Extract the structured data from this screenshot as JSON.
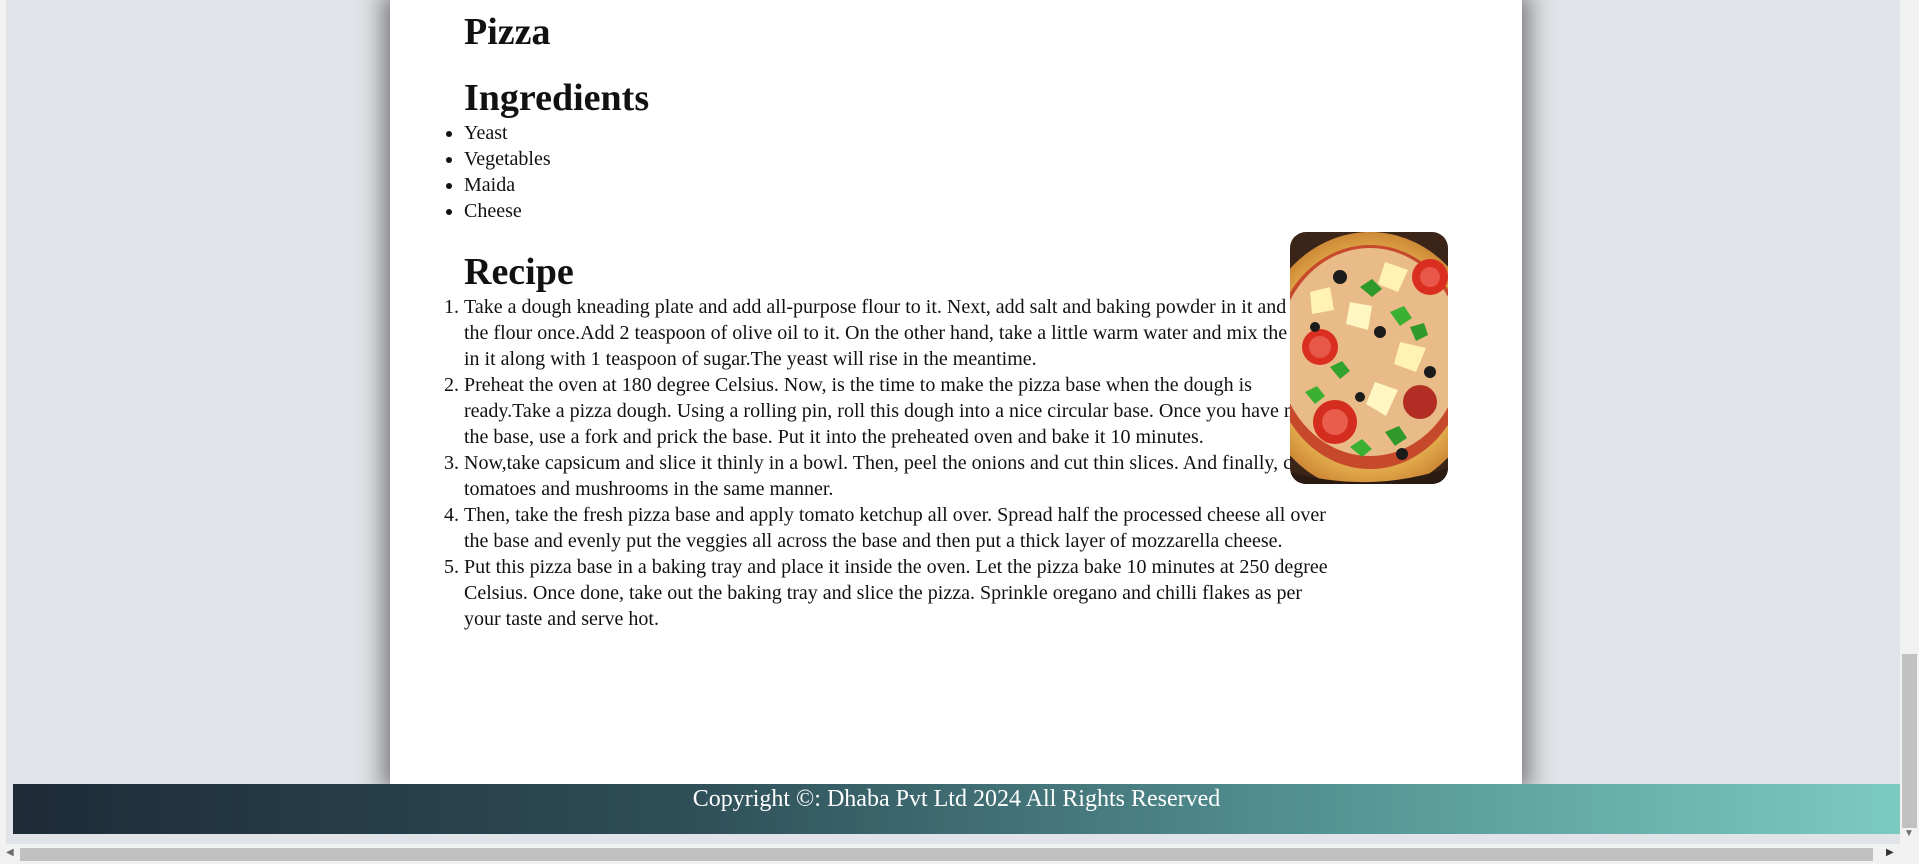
{
  "page": {
    "dish_title": "Pizza",
    "ingredients_title": "Ingredients",
    "ingredients": [
      "Yeast",
      "Vegetables",
      "Maida",
      "Cheese"
    ],
    "recipe_title": "Recipe",
    "steps": [
      "Take a dough kneading plate and add all-purpose flour to it. Next, add salt and baking powder in it and sieve the flour once.Add 2 teaspoon of olive oil to it. On the other hand, take a little warm water and mix the yeast in it along with 1 teaspoon of sugar.The yeast will rise in the meantime.",
      "Preheat the oven at 180 degree Celsius. Now, is the time to make the pizza base when the dough is ready.Take a pizza dough. Using a rolling pin, roll this dough into a nice circular base. Once you have made the base, use a fork and prick the base. Put it into the preheated oven and bake it 10 minutes.",
      "Now,take capsicum and slice it thinly in a bowl. Then, peel the onions and cut thin slices. And finally, cut tomatoes and mushrooms in the same manner.",
      "Then, take the fresh pizza base and apply tomato ketchup all over. Spread half the processed cheese all over the base and evenly put the veggies all across the base and then put a thick layer of mozzarella cheese.",
      "Put this pizza base in a baking tray and place it inside the oven. Let the pizza bake 10 minutes at 250 degree Celsius. Once done, take out the baking tray and slice the pizza. Sprinkle oregano and chilli flakes as per your taste and serve hot."
    ]
  },
  "footer": {
    "copyright": "Copyright ©: Dhaba Pvt Ltd 2024 All Rights Reserved"
  },
  "icons": {
    "scroll_up": "▲",
    "scroll_down": "▼",
    "scroll_left": "◀",
    "scroll_right": "▶"
  },
  "colors": {
    "page_background": "#e0e3e7",
    "card_background": "#ffffff",
    "footer_gradient_start": "#1d2b37",
    "footer_gradient_end": "#7ccbc2"
  }
}
